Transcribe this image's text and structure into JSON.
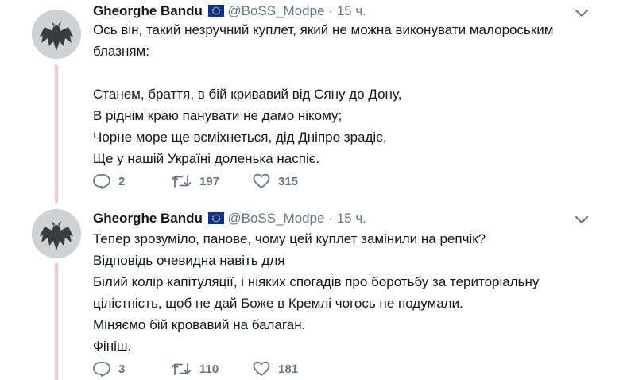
{
  "tweets": [
    {
      "author_name": "Gheorghe Bandu",
      "handle": "@BoSS_Modpe",
      "separator": "·",
      "time": "15 ч.",
      "lines": [
        "Ось він, такий незручний куплет, який не можна виконувати малороським",
        "блазням:",
        "",
        "Станем, браття, в бій кривавий від Сяну до Дону,",
        "В ріднім краю панувати не дамо нікому;",
        "Чорне море ще всміхнеться, дід Дніпро зрадіє,",
        "Ще у нашій Україні доленька наспіє."
      ],
      "replies": "2",
      "retweets": "197",
      "likes": "315"
    },
    {
      "author_name": "Gheorghe Bandu",
      "handle": "@BoSS_Modpe",
      "separator": "·",
      "time": "15 ч.",
      "lines": [
        "Тепер зрозуміло, панове, чому цей куплет замінили на репчік?",
        "Відповідь  очевидна навіть для",
        "Білий колір капітуляції, і ніяких спогадів про боротьбу за територіальну",
        "цілістність, щоб не дай Боже в Кремлі чогось не подумали.",
        "Міняємо бій кровавий на балаган.",
        "Фініш."
      ],
      "replies": "3",
      "retweets": "110",
      "likes": "181"
    }
  ],
  "icons": {
    "reply": "reply-icon",
    "retweet": "retweet-icon",
    "like": "heart-icon",
    "menu": "chevron-down-icon",
    "flag": "eu-flag-icon"
  },
  "colors": {
    "text": "#14171a",
    "secondary": "#657786",
    "thread_line": "#f0c9c6",
    "eu_blue": "#003399",
    "eu_gold": "#ffcc00"
  }
}
